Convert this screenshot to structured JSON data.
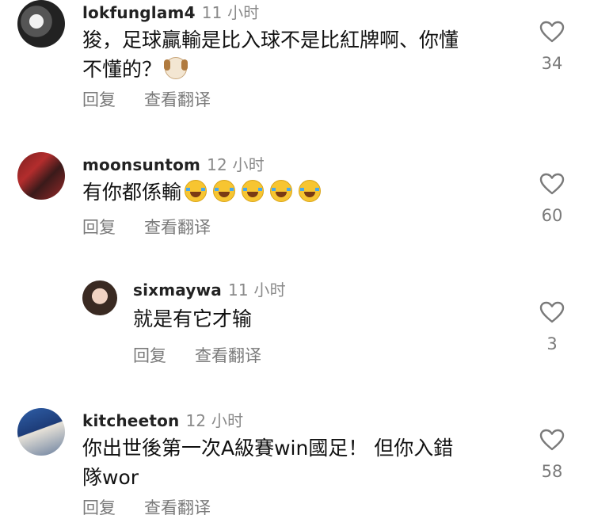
{
  "comments": [
    {
      "username": "lokfunglam4",
      "time": "11 小时",
      "lines": [
        "狻，足球贏輸是比入球不是比紅牌啊、你懂",
        "不懂的？"
      ],
      "reply_label": "回复",
      "translate_label": "查看翻译",
      "likes": "34",
      "avatar_icon": "avatar-photo",
      "emoji": "dog-face"
    },
    {
      "username": "moonsuntom",
      "time": "12 小时",
      "lines": [
        "有你都係輸"
      ],
      "reply_label": "回复",
      "translate_label": "查看翻译",
      "likes": "60",
      "avatar_icon": "avatar-photo",
      "emoji": "face-with-tears-of-joy"
    },
    {
      "username": "sixmaywa",
      "time": "11 小时",
      "lines": [
        "就是有它才输"
      ],
      "reply_label": "回复",
      "translate_label": "查看翻译",
      "likes": "3",
      "avatar_icon": "avatar-photo"
    },
    {
      "username": "kitcheeton",
      "time": "12 小时",
      "lines": [
        "你出世後第一次A級賽win國足！ 但你入錯",
        "隊wor"
      ],
      "reply_label": "回复",
      "translate_label": "查看翻译",
      "likes": "58",
      "avatar_icon": "avatar-photo"
    }
  ],
  "colors": {
    "text": "#111111",
    "muted": "#7a7a7a",
    "heart_stroke": "#7a7a7a"
  }
}
